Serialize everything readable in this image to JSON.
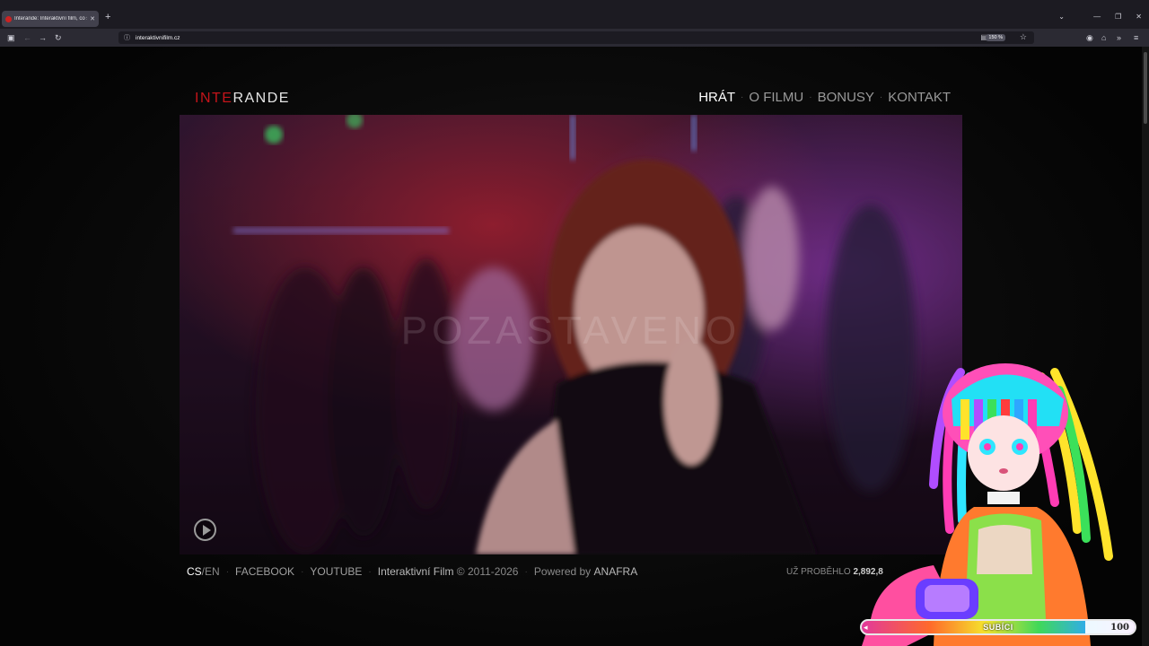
{
  "browser": {
    "tab": {
      "title": "Interande: Interaktivní film, co s"
    },
    "url": "interaktivnifilm.cz",
    "zoom": "150 %"
  },
  "site": {
    "logo": {
      "part1": "INTE",
      "part2": "RANDE"
    },
    "nav": [
      {
        "label": "HRÁT",
        "active": true
      },
      {
        "label": "O FILMU",
        "active": false
      },
      {
        "label": "BONUSY",
        "active": false
      },
      {
        "label": "KONTAKT",
        "active": false
      }
    ],
    "video": {
      "overlay_text": "POZASTAVENO"
    },
    "footer": {
      "lang_active": "CS",
      "lang_sep": "/",
      "lang_other": "EN",
      "facebook": "FACEBOOK",
      "youtube": "YOUTUBE",
      "film_name": "Interaktivní Film",
      "copyright": "© 2011-2026",
      "powered_by": "Powered by",
      "powered_brand": "ANAFRA",
      "plays_label": "UŽ PROBĚHLO",
      "plays_count": "2,892,8"
    }
  },
  "overlay": {
    "subs_label": "SUBÍCI",
    "subs_count": "100",
    "subs_fill": 0.82
  },
  "colors": {
    "logo_red": "#c4141a",
    "nav_active": "#ffffff",
    "nav_inactive": "#9a9a9a"
  }
}
